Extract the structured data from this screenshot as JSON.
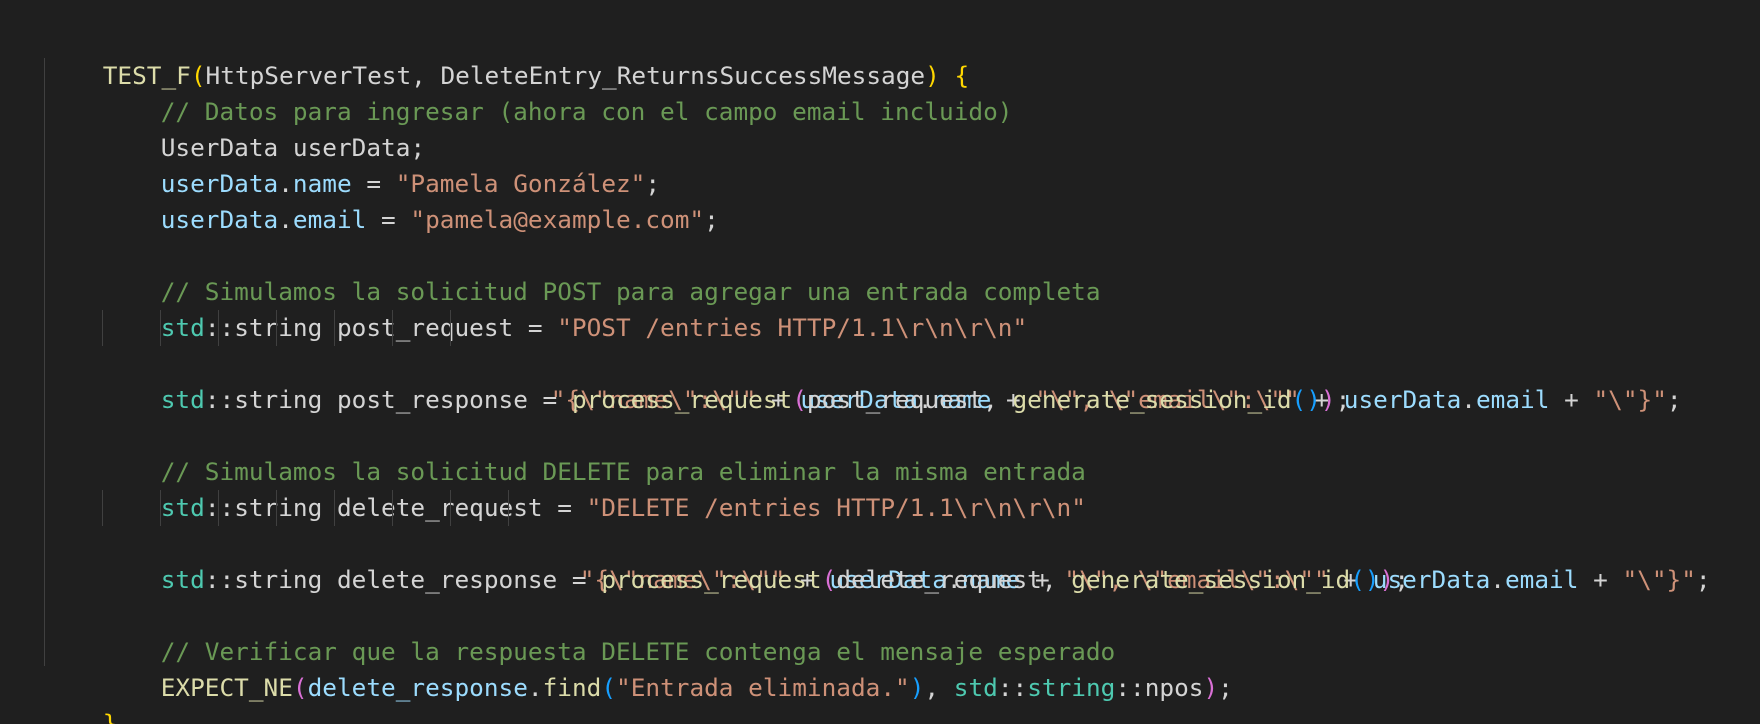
{
  "code": {
    "l1": {
      "macro": "TEST_F",
      "open": "(",
      "args": "HttpServerTest, DeleteEntry_ReturnsSuccessMessage",
      "close": ")",
      "brace": "{"
    },
    "l2": {
      "comment": "// Datos para ingresar (ahora con el campo email incluido)"
    },
    "l3": {
      "text": "UserData userData;"
    },
    "l4": {
      "obj": "userData",
      "dot": ".",
      "field": "name",
      "eq": " = ",
      "str": "\"Pamela González\"",
      "semi": ";"
    },
    "l5": {
      "obj": "userData",
      "dot": ".",
      "field": "email",
      "eq": " = ",
      "str": "\"pamela@example.com\"",
      "semi": ";"
    },
    "l7": {
      "comment": "// Simulamos la solicitud POST para agregar una entrada completa"
    },
    "l8": {
      "ns": "std",
      "sep": "::",
      "rest": "string post_request = ",
      "str": "\"POST /entries HTTP/1.1\\r\\n\\r\\n\""
    },
    "l9": {
      "s1": "\"{\\\"name\\\":\\\"\"",
      "p1": " + ",
      "o1": "userData",
      "d1": ".",
      "f1": "name",
      "p2": " + ",
      "s2": "\"\\\", \\\"email\\\":\\\"\"",
      "p3": " + ",
      "o2": "userData",
      "d2": ".",
      "f2": "email",
      "p4": " + ",
      "s3": "\"\\\"}\"",
      "semi": ";"
    },
    "l10": {
      "ns": "std",
      "sep": "::",
      "rest": "string post_response = ",
      "fn": "process_request",
      "o1": "(",
      "arg": "post_request, ",
      "fn2": "generate_session_id",
      "o2": "()",
      "c1": ")",
      "semi": ";"
    },
    "l12": {
      "comment": "// Simulamos la solicitud DELETE para eliminar la misma entrada"
    },
    "l13": {
      "ns": "std",
      "sep": "::",
      "rest": "string delete_request = ",
      "str": "\"DELETE /entries HTTP/1.1\\r\\n\\r\\n\""
    },
    "l14": {
      "s1": "\"{\\\"name\\\":\\\"\"",
      "p1": " + ",
      "o1": "userData",
      "d1": ".",
      "f1": "name",
      "p2": " + ",
      "s2": "\"\\\", \\\"email\\\":\\\"\"",
      "p3": " + ",
      "o2": "userData",
      "d2": ".",
      "f2": "email",
      "p4": " + ",
      "s3": "\"\\\"}\"",
      "semi": ";"
    },
    "l15": {
      "ns": "std",
      "sep": "::",
      "rest": "string delete_response = ",
      "fn": "process_request",
      "o1": "(",
      "arg": "delete_request, ",
      "fn2": "generate_session_id",
      "o2": "()",
      "c1": ")",
      "semi": ";"
    },
    "l17": {
      "comment": "// Verificar que la respuesta DELETE contenga el mensaje esperado"
    },
    "l18": {
      "fn": "EXPECT_NE",
      "o1": "(",
      "v1": "delete_response",
      "dot": ".",
      "fn2": "find",
      "o2": "(",
      "str": "\"Entrada eliminada.\"",
      "c2": ")",
      "comma": ", ",
      "ns": "std",
      "sep1": "::",
      "ty2": "string",
      "sep2": "::",
      "npos": "npos",
      "c1": ")",
      "semi": ";"
    },
    "l19": {
      "brace": "}"
    }
  }
}
